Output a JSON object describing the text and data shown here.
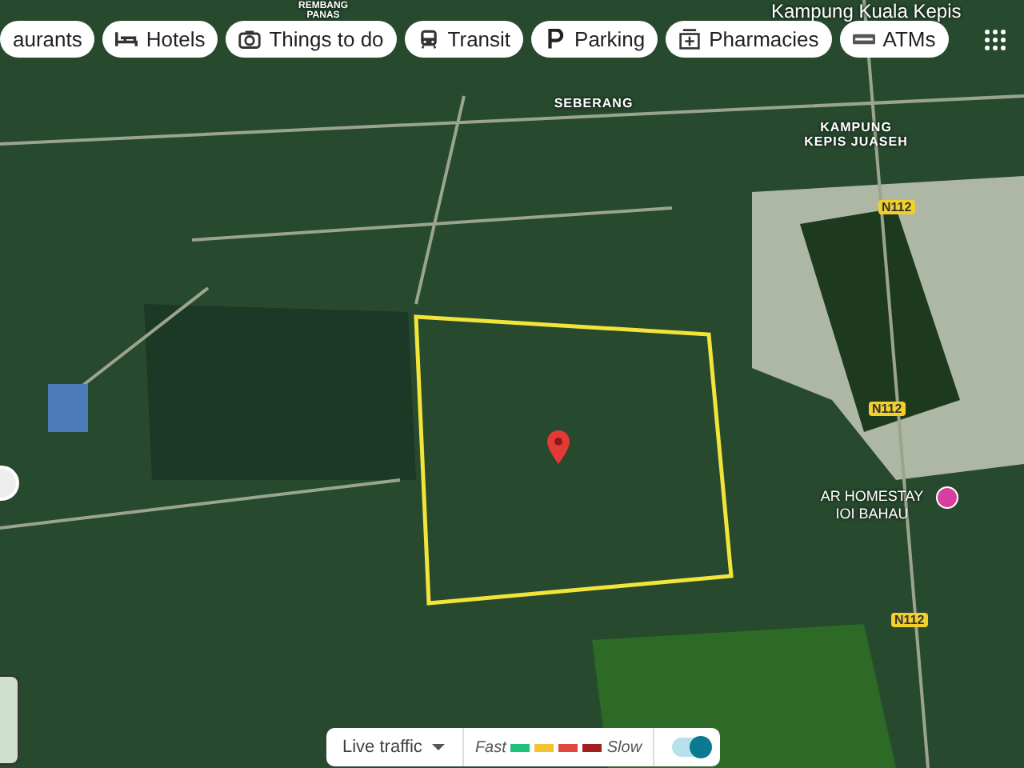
{
  "chips": [
    {
      "label": "aurants"
    },
    {
      "label": "Hotels"
    },
    {
      "label": "Things to do"
    },
    {
      "label": "Transit"
    },
    {
      "label": "Parking"
    },
    {
      "label": "Pharmacies"
    },
    {
      "label": "ATMs"
    }
  ],
  "map_labels": [
    {
      "text": "REMBANG PANAS",
      "kind": "area"
    },
    {
      "text": "Kampung Kuala Kepis",
      "kind": "place"
    },
    {
      "text": "SEBERANG",
      "kind": "area"
    },
    {
      "text": "KAMPUNG KEPIS JUASEH",
      "kind": "area"
    },
    {
      "text": "N112",
      "kind": "shield"
    },
    {
      "text": "N112",
      "kind": "shield"
    },
    {
      "text": "AR HOMESTAY IOI BAHAU",
      "kind": "poi"
    },
    {
      "text": "N112",
      "kind": "shield"
    }
  ],
  "traffic": {
    "label": "Live traffic",
    "fast": "Fast",
    "slow": "Slow",
    "legend": [
      {
        "color": "#1fc27d"
      },
      {
        "color": "#f2c230"
      },
      {
        "color": "#e0483d"
      },
      {
        "color": "#a41e22"
      }
    ],
    "on": true
  }
}
